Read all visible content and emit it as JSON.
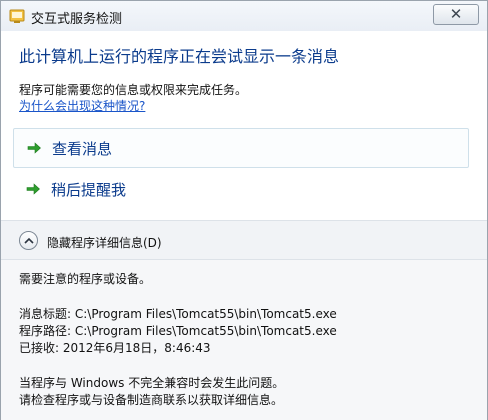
{
  "window": {
    "title": "交互式服务检测",
    "close_glyph": "✕"
  },
  "message": {
    "heading": "此计算机上运行的程序正在尝试显示一条消息",
    "description": "程序可能需要您的信息或权限来完成任务。",
    "help_link": "为什么会出现这种情况?"
  },
  "commands": [
    {
      "label": "查看消息",
      "icon": "green-arrow-icon"
    },
    {
      "label": "稍后提醒我",
      "icon": "green-arrow-icon"
    }
  ],
  "details_toggle": {
    "label": "隐藏程序详细信息(D)",
    "icon": "chevron-up-icon"
  },
  "details": {
    "intro": "需要注意的程序或设备。",
    "message_title": "消息标题: C:\\Program Files\\Tomcat55\\bin\\Tomcat5.exe",
    "program_path": "程序路径: C:\\Program Files\\Tomcat55\\bin\\Tomcat5.exe",
    "received": "已接收: 2012年6月18日，8:46:43",
    "note_line1": "当程序与 Windows 不完全兼容时会发生此问题。",
    "note_line2": "请检查程序或与设备制造商联系以获取详细信息。"
  },
  "colors": {
    "heading": "#0b3b8c",
    "link": "#1a55c9",
    "arrow": "#2e9e2e"
  }
}
